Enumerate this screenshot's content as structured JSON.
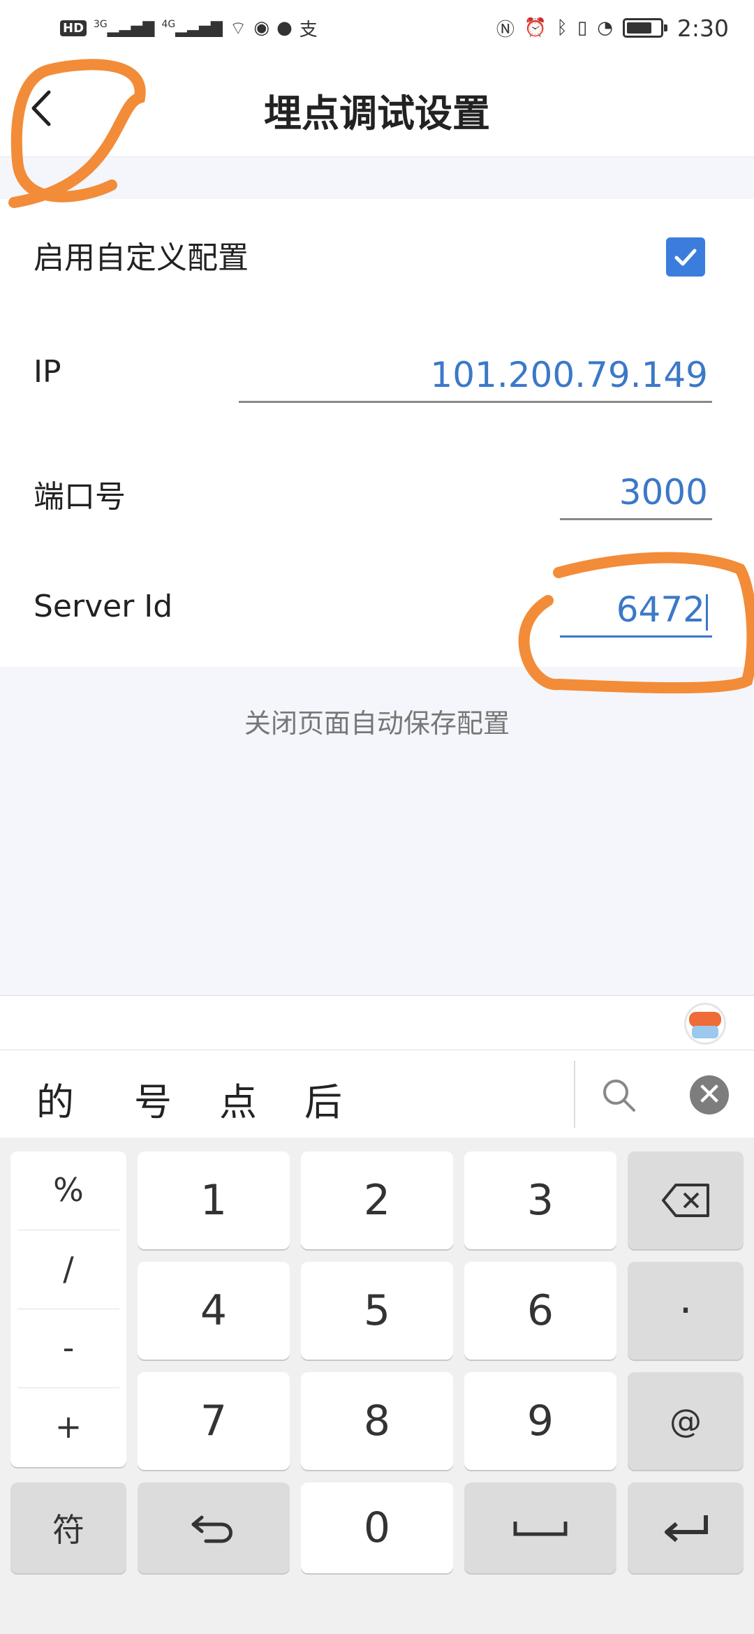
{
  "status_bar": {
    "left_icons": [
      "hd-icon",
      "signal-3g-icon",
      "signal-4g-icon",
      "wifi-icon",
      "eye-icon",
      "chat-icon",
      "alipay-icon"
    ],
    "right_icons": [
      "nfc-icon",
      "alarm-icon",
      "bluetooth-icon",
      "vibrate-icon",
      "speed-icon"
    ],
    "hd_label": "HD",
    "net_3g": "3G",
    "net_4g": "4G",
    "battery_level": 0.75,
    "time": "2:30"
  },
  "header": {
    "title": "埋点调试设置",
    "back_icon": "chevron-left-icon"
  },
  "settings": {
    "custom_config_label": "启用自定义配置",
    "custom_config_checked": true,
    "ip_label": "IP",
    "ip_value": "101.200.79.149",
    "port_label": "端口号",
    "port_value": "3000",
    "server_id_label": "Server Id",
    "server_id_value": "6472"
  },
  "hint": "关闭页面自动保存配置",
  "keyboard": {
    "candidates": [
      "的",
      "号",
      "点",
      "后"
    ],
    "symbols": [
      "%",
      "/",
      "-",
      "+"
    ],
    "digits": [
      "1",
      "2",
      "3",
      "4",
      "5",
      "6",
      "7",
      "8",
      "9",
      "0"
    ],
    "dot_key": "·",
    "at_key": "@",
    "symbol_switch": "符",
    "colors": {
      "accent": "#3b78c8",
      "key_bg": "#ffffff",
      "func_key_bg": "#dcdcdc",
      "board_bg": "#f0f0f0"
    }
  },
  "annotation_color": "#f28c38"
}
